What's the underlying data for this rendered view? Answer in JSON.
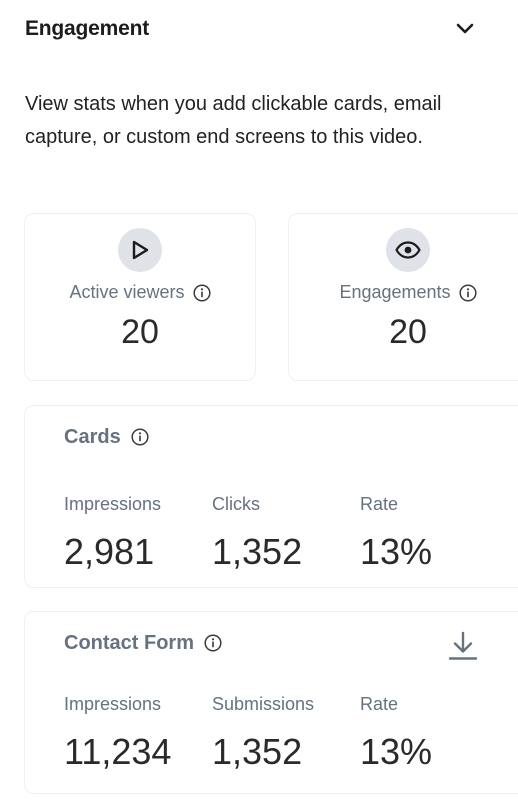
{
  "section": {
    "title": "Engagement",
    "description": "View stats when you add clickable cards, email capture, or custom end screens to this video."
  },
  "stats": [
    {
      "label": "Active viewers",
      "value": "20",
      "icon": "play-icon"
    },
    {
      "label": "Engagements",
      "value": "20",
      "icon": "eye-icon"
    }
  ],
  "cards": {
    "title": "Cards",
    "metrics": [
      {
        "label": "Impressions",
        "value": "2,981"
      },
      {
        "label": "Clicks",
        "value": "1,352"
      },
      {
        "label": "Rate",
        "value": "13%"
      }
    ]
  },
  "contact_form": {
    "title": "Contact Form",
    "metrics": [
      {
        "label": "Impressions",
        "value": "11,234"
      },
      {
        "label": "Submissions",
        "value": "1,352"
      },
      {
        "label": "Rate",
        "value": "13%"
      }
    ]
  },
  "colors": {
    "text_dark": "#1c1c1c",
    "text_muted": "#66727f",
    "icon_bg": "#dfe3e7",
    "card_border": "#eef0f2"
  }
}
